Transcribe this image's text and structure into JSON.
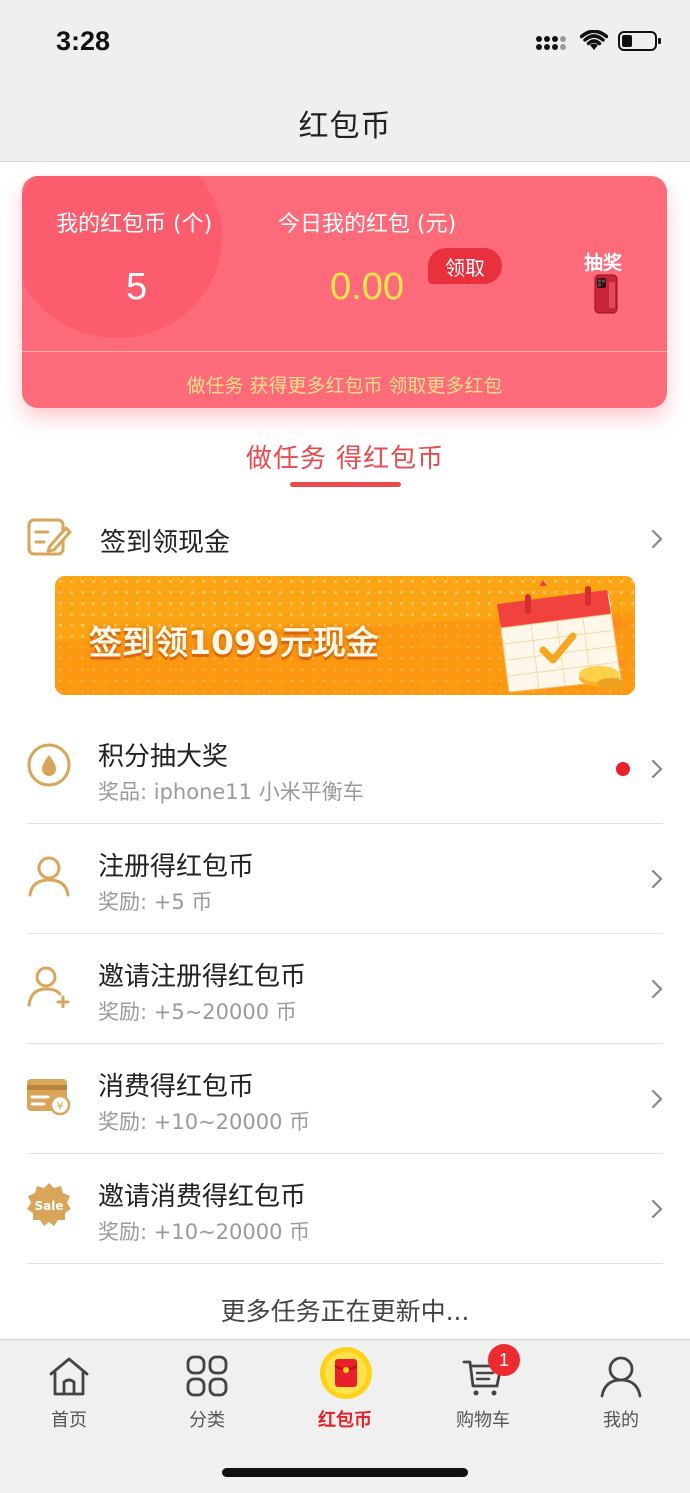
{
  "status_bar": {
    "time": "3:28",
    "icons": [
      "signal-icon",
      "wifi-icon",
      "battery-icon"
    ]
  },
  "nav": {
    "title": "红包币"
  },
  "card": {
    "my_coins_label": "我的红包币 (个)",
    "my_coins_value": "5",
    "today_label": "今日我的红包 (元)",
    "today_value": "0.00",
    "claim_label": "领取",
    "lottery_label": "抽奖",
    "tip": "做任务 获得更多红包币 领取更多红包",
    "colors": {
      "card": "#fd6b7b",
      "amount": "#ffe64a",
      "tip": "#ffe08a"
    }
  },
  "section": {
    "title": "做任务 得红包币",
    "accent": "#e84a4e"
  },
  "signin": {
    "label": "签到领现金",
    "banner_text": "签到领1099元现金"
  },
  "tasks": [
    {
      "title": "积分抽大奖",
      "subtitle": "奖品: iphone11 小米平衡车",
      "icon": "lottery-drop-icon",
      "has_dot": true
    },
    {
      "title": "注册得红包币",
      "subtitle": "奖励: +5 币",
      "icon": "user-icon"
    },
    {
      "title": "邀请注册得红包币",
      "subtitle": "奖励: +5~20000 币",
      "icon": "invite-user-icon"
    },
    {
      "title": "消费得红包币",
      "subtitle": "奖励: +10~20000 币",
      "icon": "payment-card-icon"
    },
    {
      "title": "邀请消费得红包币",
      "subtitle": "奖励: +10~20000 币",
      "icon": "sale-badge-icon"
    }
  ],
  "more_tasks": "更多任务正在更新中...",
  "tabbar": {
    "items": [
      {
        "label": "首页",
        "icon": "home-icon"
      },
      {
        "label": "分类",
        "icon": "category-icon"
      },
      {
        "label": "红包币",
        "icon": "red-envelope-icon",
        "active": true
      },
      {
        "label": "购物车",
        "icon": "cart-icon",
        "badge": "1"
      },
      {
        "label": "我的",
        "icon": "profile-icon"
      }
    ],
    "active_color": "#e8202a"
  }
}
